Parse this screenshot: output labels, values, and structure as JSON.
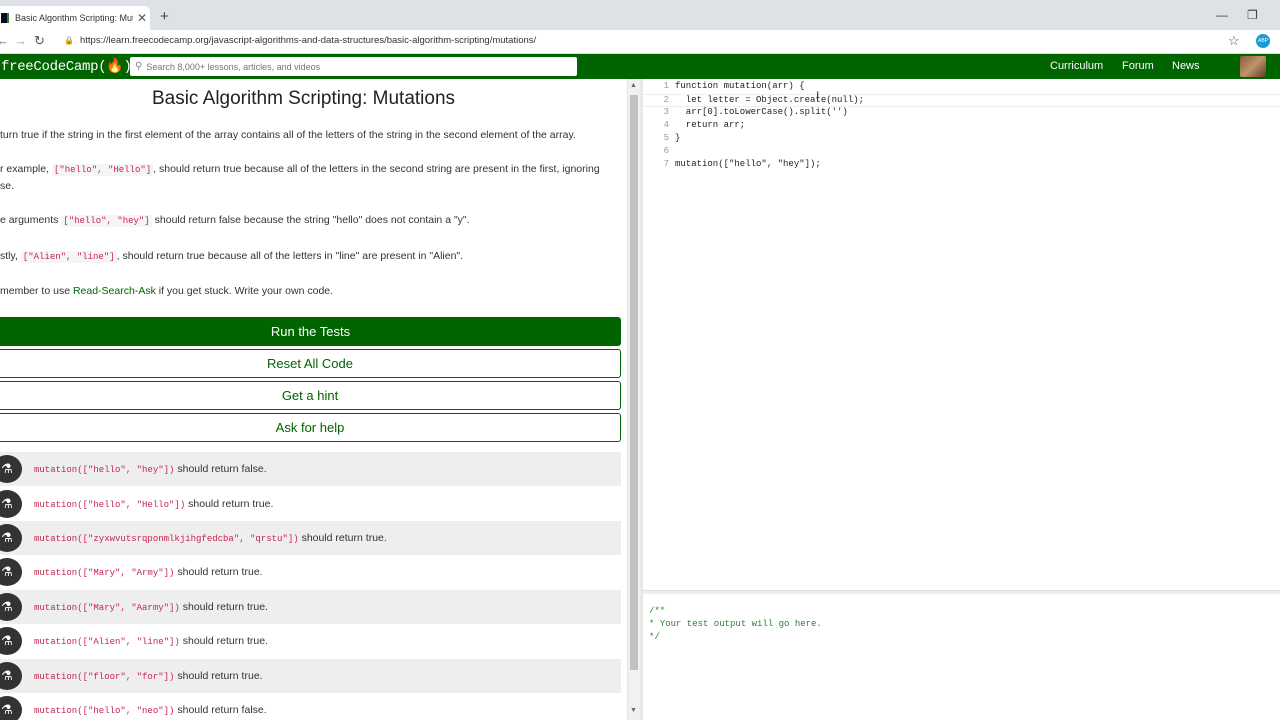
{
  "browser": {
    "tab_title": "Basic Algorithm Scripting: Mutati",
    "tab_close": "✕",
    "new_tab": "+",
    "url": "https://learn.freecodecamp.org/javascript-algorithms-and-data-structures/basic-algorithm-scripting/mutations/",
    "win_min": "—",
    "win_max": "❐",
    "back": "←",
    "forward": "→",
    "reload": "↻",
    "lock": "🔒",
    "star": "☆",
    "ext_label": "ABP"
  },
  "nav": {
    "logo": "freeCodeCamp(🔥)",
    "search_placeholder": "Search 8,000+ lessons, articles, and videos",
    "links": [
      "Curriculum",
      "Forum",
      "News"
    ]
  },
  "challenge": {
    "title": "Basic Algorithm Scripting: Mutations",
    "p1": "turn true if the string in the first element of the array contains all of the letters of the string in the second element of the array.",
    "p2_pre": "r example, ",
    "p2_code": "[\"hello\", \"Hello\"]",
    "p2_post": ", should return true because all of the letters in the second string are present in the first, ignoring",
    "p2_cont": "se.",
    "p3_pre": "e arguments ",
    "p3_code": "[\"hello\", \"hey\"]",
    "p3_post": " should return false because the string \"hello\" does not contain a \"y\".",
    "p4_pre": "stly, ",
    "p4_code": "[\"Alien\", \"line\"]",
    "p4_post": ", should return true because all of the letters in \"line\" are present in \"Alien\".",
    "p5_pre": "member to use ",
    "p5_link": "Read-Search-Ask",
    "p5_post": " if you get stuck. Write your own code."
  },
  "buttons": {
    "run": "Run the Tests",
    "reset": "Reset All Code",
    "hint": "Get a hint",
    "help": "Ask for help"
  },
  "tests": [
    {
      "code": "mutation([\"hello\", \"hey\"])",
      "text": " should return false."
    },
    {
      "code": "mutation([\"hello\", \"Hello\"])",
      "text": " should return true."
    },
    {
      "code": "mutation([\"zyxwvutsrqponmlkjihgfedcba\", \"qrstu\"])",
      "text": " should return true."
    },
    {
      "code": "mutation([\"Mary\", \"Army\"])",
      "text": " should return true."
    },
    {
      "code": "mutation([\"Mary\", \"Aarmy\"])",
      "text": " should return true."
    },
    {
      "code": "mutation([\"Alien\", \"line\"])",
      "text": " should return true."
    },
    {
      "code": "mutation([\"floor\", \"for\"])",
      "text": " should return true."
    },
    {
      "code": "mutation([\"hello\", \"neo\"])",
      "text": " should return false."
    }
  ],
  "editor": {
    "lines": [
      {
        "n": "1",
        "text": "function mutation(arr) {"
      },
      {
        "n": "2",
        "text": "  let letter = Object.create(null);"
      },
      {
        "n": "3",
        "text": "  arr[0].toLowerCase().split('')"
      },
      {
        "n": "4",
        "text": "  return arr;"
      },
      {
        "n": "5",
        "text": "}"
      },
      {
        "n": "6",
        "text": ""
      },
      {
        "n": "7",
        "text": "mutation([\"hello\", \"hey\"]);"
      }
    ]
  },
  "output": {
    "lines": [
      "/**",
      "* Your test output will go here.",
      "*/"
    ]
  },
  "icons": {
    "flask": "⚗",
    "search": "⚲",
    "scroll_up": "▲",
    "scroll_down": "▼",
    "text_cursor": "I"
  }
}
